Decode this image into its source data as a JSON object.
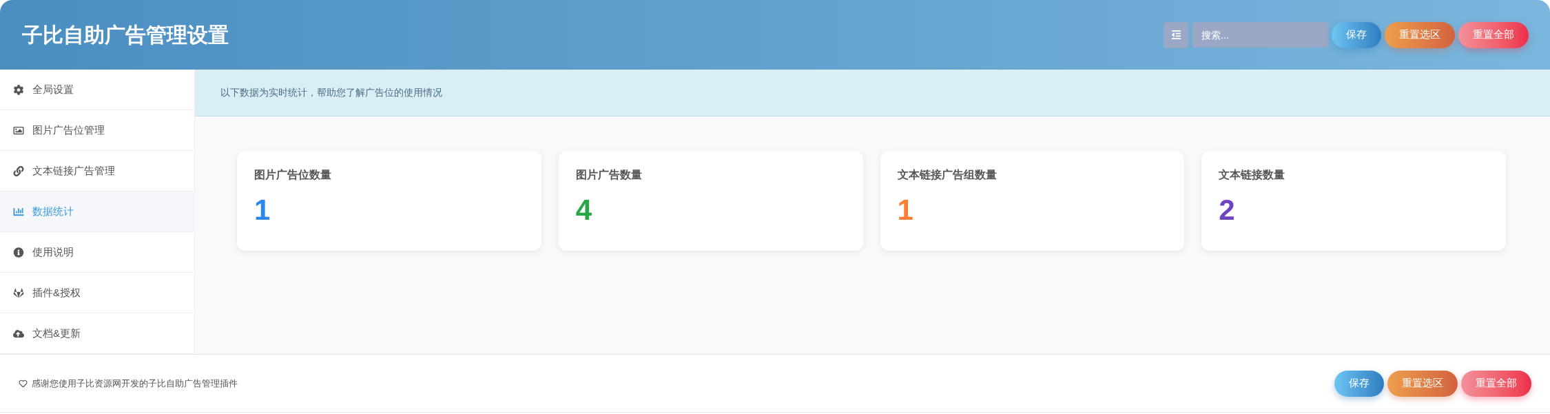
{
  "header": {
    "title": "子比自助广告管理设置",
    "search": {
      "placeholder": "搜索..."
    },
    "buttons": [
      {
        "label": "保存",
        "kind": "save"
      },
      {
        "label": "重置选区",
        "kind": "reset_section"
      },
      {
        "label": "重置全部",
        "kind": "reset_all"
      }
    ]
  },
  "sidebar": {
    "items": [
      {
        "label": "全局设置",
        "selected": false
      },
      {
        "label": "图片广告位管理",
        "selected": false
      },
      {
        "label": "文本链接广告管理",
        "selected": false
      },
      {
        "label": "数据统计",
        "selected": true
      },
      {
        "label": "使用说明",
        "selected": false
      },
      {
        "label": "插件&授权",
        "selected": false
      },
      {
        "label": "文档&更新",
        "selected": false
      }
    ]
  },
  "notice": "以下数据为实时统计，帮助您了解广告位的使用情况",
  "stats": [
    {
      "label": "图片广告位数量",
      "value": "1",
      "color": "#2b87f0"
    },
    {
      "label": "图片广告数量",
      "value": "4",
      "color": "#28a745"
    },
    {
      "label": "文本链接广告组数量",
      "value": "1",
      "color": "#fd7e30"
    },
    {
      "label": "文本链接数量",
      "value": "2",
      "color": "#6f42c1"
    }
  ],
  "footer": {
    "text": "感谢您使用子比资源网开发的子比自助广告管理插件",
    "buttons": [
      {
        "label": "保存",
        "kind": "save"
      },
      {
        "label": "重置选区",
        "kind": "reset_section"
      },
      {
        "label": "重置全部",
        "kind": "reset_all"
      }
    ]
  }
}
